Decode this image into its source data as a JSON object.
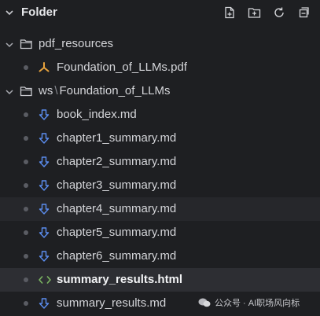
{
  "header": {
    "title": "Folder",
    "actions": [
      {
        "name": "new-file",
        "icon": "new-file-icon"
      },
      {
        "name": "new-folder",
        "icon": "new-folder-icon"
      },
      {
        "name": "refresh",
        "icon": "refresh-icon"
      },
      {
        "name": "collapse-all",
        "icon": "collapse-all-icon"
      }
    ]
  },
  "tree": {
    "folders": [
      {
        "label": "pdf_resources",
        "expanded": true
      },
      {
        "label_prefix": "ws",
        "label_sep": "\\",
        "label_rest": "Foundation_of_LLMs",
        "expanded": true
      }
    ],
    "files": [
      {
        "label": "Foundation_of_LLMs.pdf",
        "icon": "pdf-link-icon"
      },
      {
        "label": "book_index.md",
        "icon": "download-arrow-icon"
      },
      {
        "label": "chapter1_summary.md",
        "icon": "download-arrow-icon"
      },
      {
        "label": "chapter2_summary.md",
        "icon": "download-arrow-icon"
      },
      {
        "label": "chapter3_summary.md",
        "icon": "download-arrow-icon"
      },
      {
        "label": "chapter4_summary.md",
        "icon": "download-arrow-icon"
      },
      {
        "label": "chapter5_summary.md",
        "icon": "download-arrow-icon"
      },
      {
        "label": "chapter6_summary.md",
        "icon": "download-arrow-icon"
      },
      {
        "label": "summary_results.html",
        "icon": "code-brackets-icon"
      },
      {
        "label": "summary_results.md",
        "icon": "download-arrow-icon"
      }
    ]
  },
  "watermark": {
    "text": "公众号 · AI职场风向标"
  },
  "colors": {
    "background": "#1e1f22",
    "active_row": "#2d2e33",
    "hover_row": "#26272b",
    "file_icon_blue": "#5b8def",
    "pdf_icon_orange": "#e8a33d",
    "html_icon_green": "#7bb661"
  }
}
